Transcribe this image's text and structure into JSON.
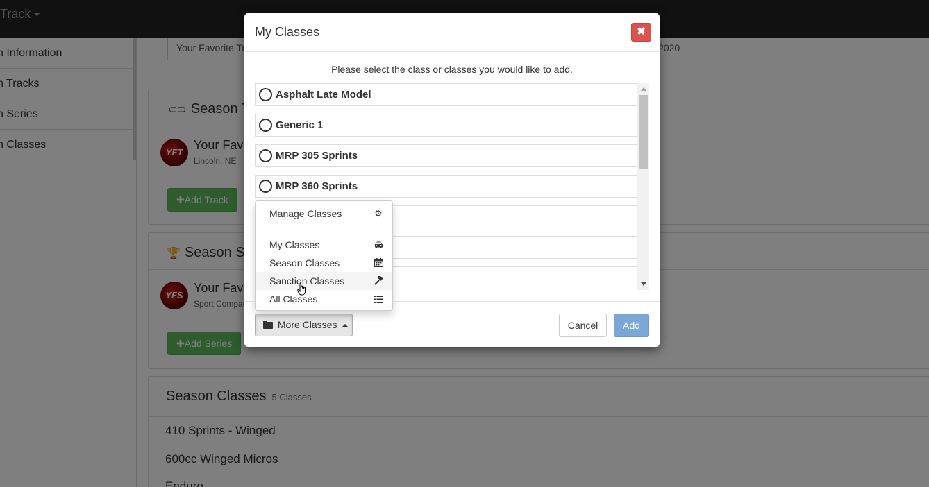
{
  "page": {
    "brand": "Track",
    "sidebar": {
      "items": [
        {
          "label": "n Information"
        },
        {
          "label": "n Tracks"
        },
        {
          "label": "n Series"
        },
        {
          "label": "n Classes"
        }
      ]
    },
    "top_input": {
      "left_text": "Your Favorite Tr",
      "right_text": "2020"
    },
    "season_tracks": {
      "title": "Season T",
      "track_name": "Your Fav",
      "track_location": "Lincoln, NE",
      "logo_text": "YFT",
      "add_button": "Add Track"
    },
    "season_series": {
      "title": "Season S",
      "series_name": "Your Fav",
      "series_sub": "Sport Compac",
      "logo_text": "YFS",
      "add_button": "Add Series"
    },
    "season_classes": {
      "title": "Season Classes",
      "count": "5 Classes",
      "rows": [
        "410 Sprints - Winged",
        "600cc Winged Micros",
        "Enduro"
      ]
    }
  },
  "modal": {
    "title": "My Classes",
    "close_symbol": "✖",
    "instructions": "Please select the class or classes you would like to add.",
    "classes": [
      {
        "label": "Asphalt Late Model"
      },
      {
        "label": "Generic 1"
      },
      {
        "label": "MRP 305 Sprints"
      },
      {
        "label": "MRP 360 Sprints"
      },
      {
        "label": ""
      },
      {
        "label": ""
      },
      {
        "label": ""
      }
    ],
    "footer": {
      "more_button": "More Classes",
      "cancel_button": "Cancel",
      "add_button": "Add"
    }
  },
  "dropdown": {
    "items": [
      {
        "label": "Manage Classes",
        "icon": "⚙",
        "icon_name": "gear-icon"
      },
      {
        "label": "My Classes",
        "icon": "🚘",
        "icon_name": "car-icon"
      },
      {
        "label": "Season Classes",
        "icon": "📅",
        "icon_name": "calendar-icon"
      },
      {
        "label": "Sanction Classes",
        "icon": "🔨",
        "icon_name": "gavel-icon"
      },
      {
        "label": "All Classes",
        "icon": "☰",
        "icon_name": "list-icon"
      }
    ],
    "hovered": "Sanction Classes"
  }
}
